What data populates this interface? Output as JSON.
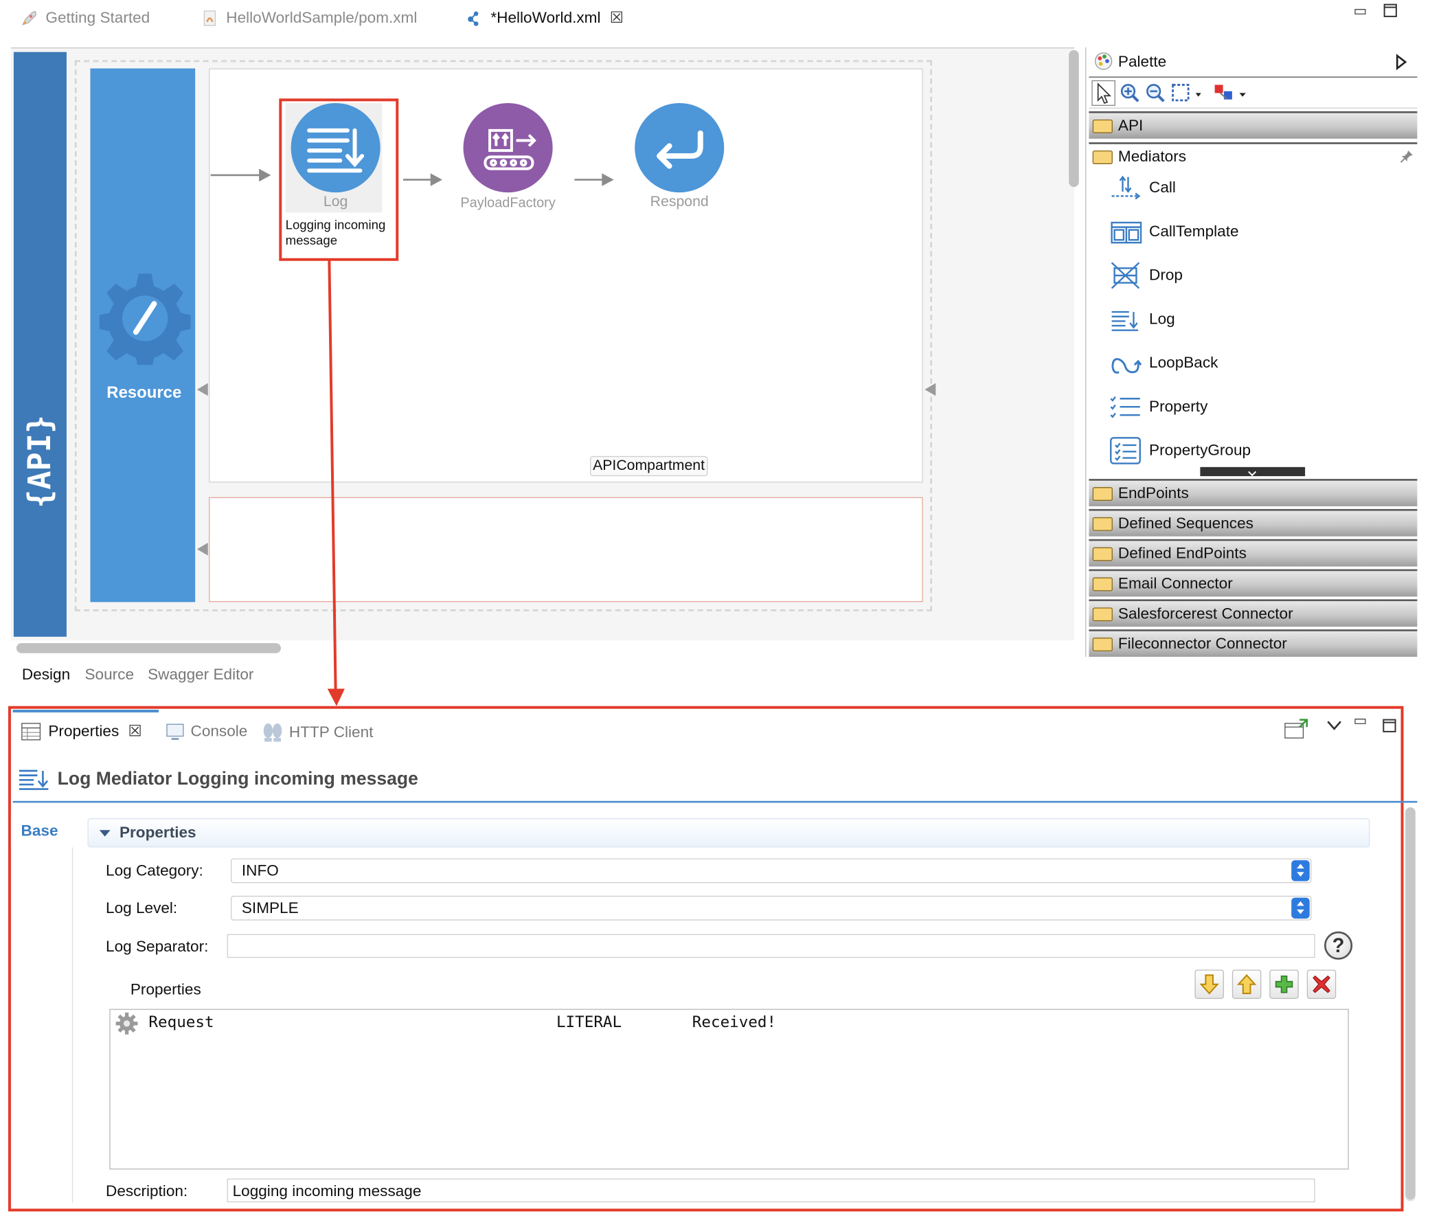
{
  "editor_tabs": [
    {
      "label": "Getting Started",
      "active": false
    },
    {
      "label": "HelloWorldSample/pom.xml",
      "active": false
    },
    {
      "label": "*HelloWorld.xml",
      "active": true
    }
  ],
  "canvas": {
    "api_logo": "{API}",
    "resource_label": "Resource",
    "mediators": [
      {
        "name": "Log",
        "description": "Logging incoming message",
        "color": "#4d96d8"
      },
      {
        "name": "PayloadFactory",
        "color": "#8e5ba8"
      },
      {
        "name": "Respond",
        "color": "#4d96d8"
      }
    ],
    "compartment_label": "APICompartment",
    "highlight_color": "#e23b2a"
  },
  "bottom_tabs": [
    "Design",
    "Source",
    "Swagger Editor"
  ],
  "palette": {
    "title": "Palette",
    "drawers_top": [
      "API",
      "Mediators"
    ],
    "mediator_items": [
      "Call",
      "CallTemplate",
      "Drop",
      "Log",
      "LoopBack",
      "Property",
      "PropertyGroup"
    ],
    "drawers_bottom": [
      "EndPoints",
      "Defined Sequences",
      "Defined EndPoints",
      "Email Connector",
      "Salesforcerest Connector",
      "Fileconnector Connector"
    ]
  },
  "properties_view": {
    "tabs": [
      "Properties",
      "Console",
      "HTTP Client"
    ],
    "title": "Log Mediator Logging incoming message",
    "side_tab": "Base",
    "section_title": "Properties",
    "fields": {
      "log_category_label": "Log Category:",
      "log_category_value": "INFO",
      "log_level_label": "Log Level:",
      "log_level_value": "SIMPLE",
      "log_separator_label": "Log Separator:",
      "log_separator_value": "",
      "properties_label": "Properties",
      "description_label": "Description:",
      "description_value": "Logging incoming message"
    },
    "table_rows": [
      {
        "name": "Request",
        "type": "LITERAL",
        "value": "Received!"
      }
    ]
  }
}
